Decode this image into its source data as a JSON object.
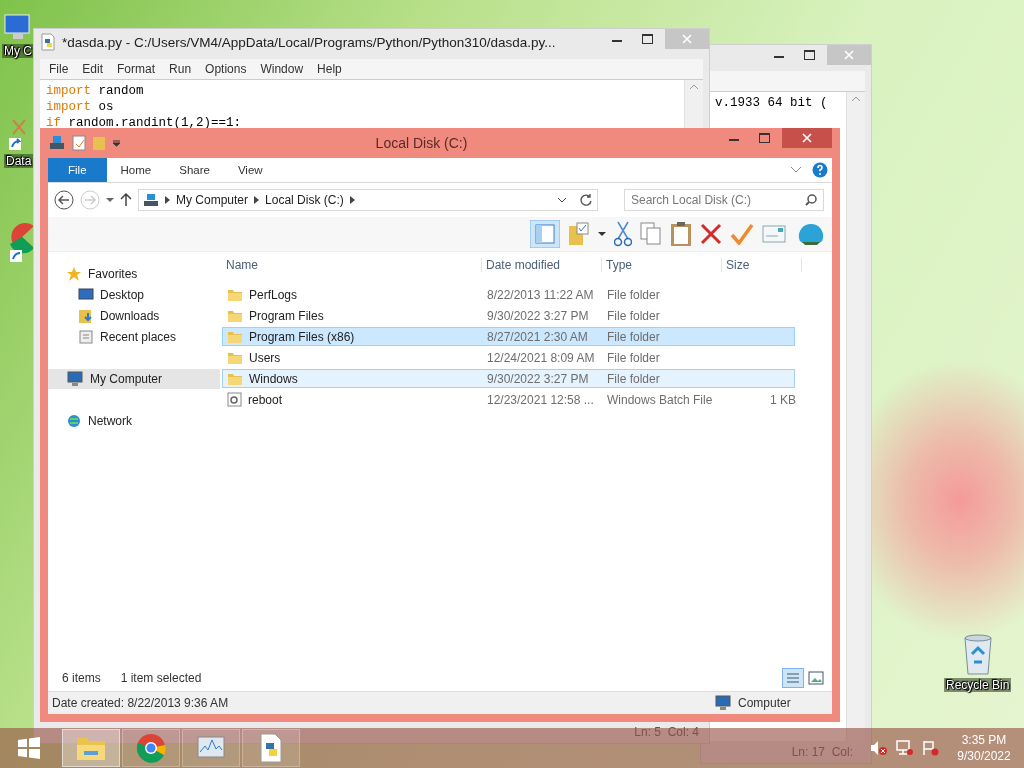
{
  "desktop_icons": [
    {
      "kind": "computer",
      "label": "My C"
    },
    {
      "kind": "shortcut",
      "label": "Data"
    },
    {
      "kind": "browser"
    },
    {
      "kind": "recycle",
      "label": "Recycle Bin"
    }
  ],
  "shell_window": {
    "lines": [
      "v.1933 64 bit ("
    ],
    "status": "Ln: 17  Col:"
  },
  "editor_window": {
    "title": "*dasda.py - C:/Users/VM4/AppData/Local/Programs/Python/Python310/dasda.py...",
    "menu": [
      "File",
      "Edit",
      "Format",
      "Run",
      "Options",
      "Window",
      "Help"
    ],
    "code": [
      [
        {
          "kind": "keyword",
          "text": "import"
        },
        {
          "kind": "plain",
          "text": " random"
        }
      ],
      [
        {
          "kind": "keyword",
          "text": "import"
        },
        {
          "kind": "plain",
          "text": " os"
        }
      ],
      [
        {
          "kind": "keyword",
          "text": "if"
        },
        {
          "kind": "plain",
          "text": " random.randint(1,2)==1:"
        }
      ]
    ],
    "status": "Ln: 5  Col: 4"
  },
  "explorer": {
    "title": "Local Disk (C:)",
    "ribbon_tabs": [
      {
        "label": "File",
        "selected": true
      },
      {
        "label": "Home",
        "selected": false
      },
      {
        "label": "Share",
        "selected": false
      },
      {
        "label": "View",
        "selected": false
      }
    ],
    "breadcrumb": [
      "My Computer",
      "Local Disk (C:)"
    ],
    "search": {
      "placeholder": "Search Local Disk (C:)"
    },
    "nav": [
      {
        "kind": "favorites",
        "label": "Favorites",
        "selected": false,
        "children": [
          {
            "kind": "desktop",
            "label": "Desktop",
            "selected": false
          },
          {
            "kind": "downloads",
            "label": "Downloads",
            "selected": false
          },
          {
            "kind": "recent",
            "label": "Recent places",
            "selected": false
          }
        ]
      },
      {
        "kind": "computer",
        "label": "My Computer",
        "selected": true
      },
      {
        "kind": "network",
        "label": "Network",
        "selected": false
      }
    ],
    "columns": [
      "Name",
      "Date modified",
      "Type",
      "Size"
    ],
    "rows": [
      {
        "kind": "folder",
        "name": "PerfLogs",
        "date": "8/22/2013 11:22 AM",
        "type": "File folder",
        "selected": false,
        "hovered": false
      },
      {
        "kind": "folder",
        "name": "Program Files",
        "date": "9/30/2022 3:27 PM",
        "type": "File folder",
        "selected": false,
        "hovered": false
      },
      {
        "kind": "folder",
        "name": "Program Files (x86)",
        "date": "8/27/2021 2:30 AM",
        "type": "File folder",
        "selected": true,
        "hovered": false
      },
      {
        "kind": "folder",
        "name": "Users",
        "date": "12/24/2021 8:09 AM",
        "type": "File folder",
        "selected": false,
        "hovered": false
      },
      {
        "kind": "folder",
        "name": "Windows",
        "date": "9/30/2022 3:27 PM",
        "type": "File folder",
        "selected": false,
        "hovered": true
      },
      {
        "kind": "batch",
        "name": "reboot",
        "date": "12/23/2021 12:58 ...",
        "type": "Windows Batch File",
        "size": "1 KB",
        "selected": false,
        "hovered": false
      }
    ],
    "item_count": "6 items",
    "selection_count": "1 item selected",
    "details": "Date created: 8/22/2013 9:36 AM",
    "location": "Computer"
  },
  "taskbar": {
    "apps": [
      {
        "kind": "explorer",
        "selected": true
      },
      {
        "kind": "chrome",
        "selected": false
      },
      {
        "kind": "monitor",
        "selected": false
      },
      {
        "kind": "python",
        "selected": false
      }
    ],
    "time": "3:35 PM",
    "date": "9/30/2022"
  }
}
